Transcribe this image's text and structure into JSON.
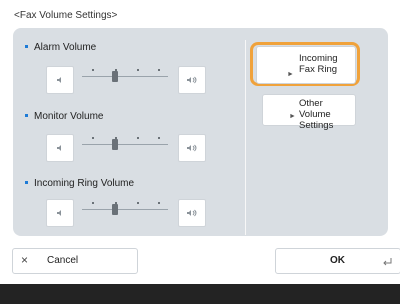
{
  "screen": {
    "title": "<Fax Volume Settings>"
  },
  "volume_controls": [
    {
      "label": "Alarm Volume",
      "level": 2,
      "max": 4
    },
    {
      "label": "Monitor Volume",
      "level": 2,
      "max": 4
    },
    {
      "label": "Incoming Ring Volume",
      "level": 2,
      "max": 4
    }
  ],
  "right_buttons": {
    "incoming_fax_ring": "Incoming\nFax Ring",
    "other_volume_settings": "Other Volume\nSettings"
  },
  "footer": {
    "cancel": "Cancel",
    "cancel_icon": "×",
    "ok": "OK"
  },
  "colors": {
    "highlight": "#f0a23b",
    "bullet": "#1e7bd6",
    "panel": "#d9dee3"
  },
  "icons": [
    "speaker-low-icon",
    "speaker-high-icon",
    "arrow-corner-icon",
    "close-icon"
  ]
}
